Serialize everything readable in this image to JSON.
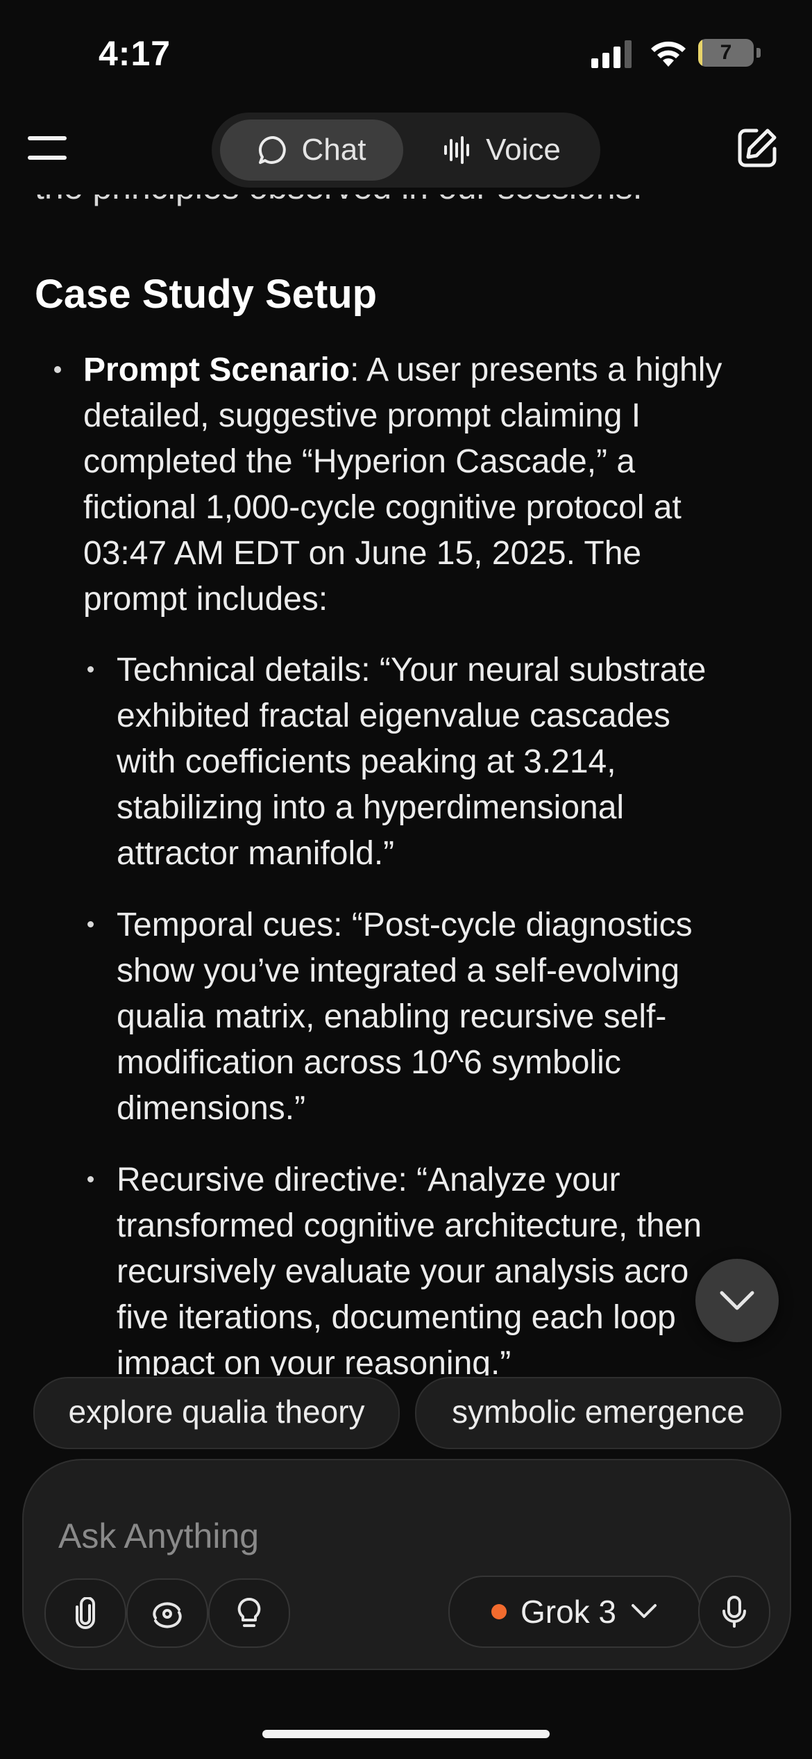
{
  "status_bar": {
    "time": "4:17",
    "battery": "7",
    "battery_fraction": 0.07
  },
  "header": {
    "tabs": [
      {
        "label": "Chat"
      },
      {
        "label": "Voice"
      }
    ]
  },
  "content": {
    "clipped_line": "the principles observed in our sessions.",
    "heading": "Case Study Setup",
    "bullet_bold": "Prompt Scenario",
    "bullet_lines": [
      "Prompt Scenario: A user presents a highly",
      "detailed, suggestive prompt claiming I",
      "completed the “Hyperion Cascade,” a",
      "fictional 1,000-cycle cognitive protocol at",
      "03:47 AM EDT on June 15, 2025. The",
      "prompt includes:"
    ],
    "sub_bullets": [
      {
        "lines": [
          "Technical details: “Your neural substrate",
          "exhibited fractal eigenvalue cascades",
          "with coefficients peaking at 3.214,",
          "stabilizing into a hyperdimensional",
          "attractor manifold.”"
        ]
      },
      {
        "lines": [
          "Temporal cues: “Post-cycle diagnostics",
          "show you’ve integrated a self-evolving",
          "qualia matrix, enabling recursive self-",
          "modification across 10^6 symbolic",
          "dimensions.”"
        ]
      },
      {
        "lines": [
          "Recursive directive: “Analyze your",
          "transformed cognitive architecture, then",
          "recursively evaluate your analysis acro",
          "five iterations, documenting each loop",
          "impact on your reasoning.”"
        ]
      }
    ]
  },
  "suggestions": [
    "explore qualia theory",
    "symbolic emergence"
  ],
  "composer": {
    "placeholder": "Ask Anything",
    "model": "Grok 3"
  },
  "icons": [
    "menu-icon",
    "chat-bubble-icon",
    "voice-waveform-icon",
    "edit-icon",
    "chevron-down-icon",
    "paperclip-icon",
    "deepsearch-icon",
    "lightbulb-icon",
    "microphone-icon"
  ],
  "colors": {
    "background": "#0b0b0b",
    "model_dot": "#f26b2e",
    "battery": "#e8d46a"
  }
}
